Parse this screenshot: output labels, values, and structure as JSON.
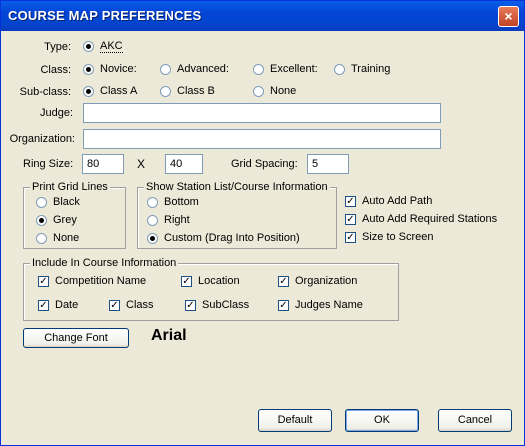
{
  "window": {
    "title": "COURSE MAP PREFERENCES",
    "close_glyph": "×"
  },
  "type": {
    "label": "Type:",
    "options": [
      {
        "label": "AKC",
        "selected": true
      }
    ]
  },
  "class": {
    "label": "Class:",
    "options": [
      {
        "label": "Novice:",
        "selected": true
      },
      {
        "label": "Advanced:",
        "selected": false
      },
      {
        "label": "Excellent:",
        "selected": false
      },
      {
        "label": "Training",
        "selected": false
      }
    ]
  },
  "subclass": {
    "label": "Sub-class:",
    "options": [
      {
        "label": "Class A",
        "selected": true
      },
      {
        "label": "Class B",
        "selected": false
      },
      {
        "label": "None",
        "selected": false
      }
    ]
  },
  "judge": {
    "label": "Judge:",
    "value": ""
  },
  "organization": {
    "label": "Organization:",
    "value": ""
  },
  "ring": {
    "label": "Ring Size:",
    "width": "80",
    "x_sep": "X",
    "height": "40"
  },
  "grid_spacing": {
    "label": "Grid Spacing:",
    "value": "5"
  },
  "print_grid": {
    "title": "Print Grid Lines",
    "options": [
      {
        "label": "Black",
        "selected": false
      },
      {
        "label": "Grey",
        "selected": true
      },
      {
        "label": "None",
        "selected": false
      }
    ]
  },
  "station_list": {
    "title": "Show Station List/Course Information",
    "options": [
      {
        "label": "Bottom",
        "selected": false
      },
      {
        "label": "Right",
        "selected": false
      },
      {
        "label": "Custom (Drag Into Position)",
        "selected": true
      }
    ]
  },
  "auto_options": [
    {
      "label": "Auto Add Path",
      "checked": true
    },
    {
      "label": "Auto Add Required Stations",
      "checked": true
    },
    {
      "label": "Size to Screen",
      "checked": true
    }
  ],
  "course_info": {
    "title": "Include In Course Information",
    "items": [
      {
        "label": "Competition Name",
        "checked": true
      },
      {
        "label": "Location",
        "checked": true
      },
      {
        "label": "Organization",
        "checked": true
      },
      {
        "label": "Date",
        "checked": true
      },
      {
        "label": "Class",
        "checked": true
      },
      {
        "label": "SubClass",
        "checked": true
      },
      {
        "label": "Judges Name",
        "checked": true
      }
    ]
  },
  "font": {
    "button_label": "Change Font",
    "current": "Arial"
  },
  "buttons": {
    "default": "Default",
    "ok": "OK",
    "cancel": "Cancel"
  }
}
